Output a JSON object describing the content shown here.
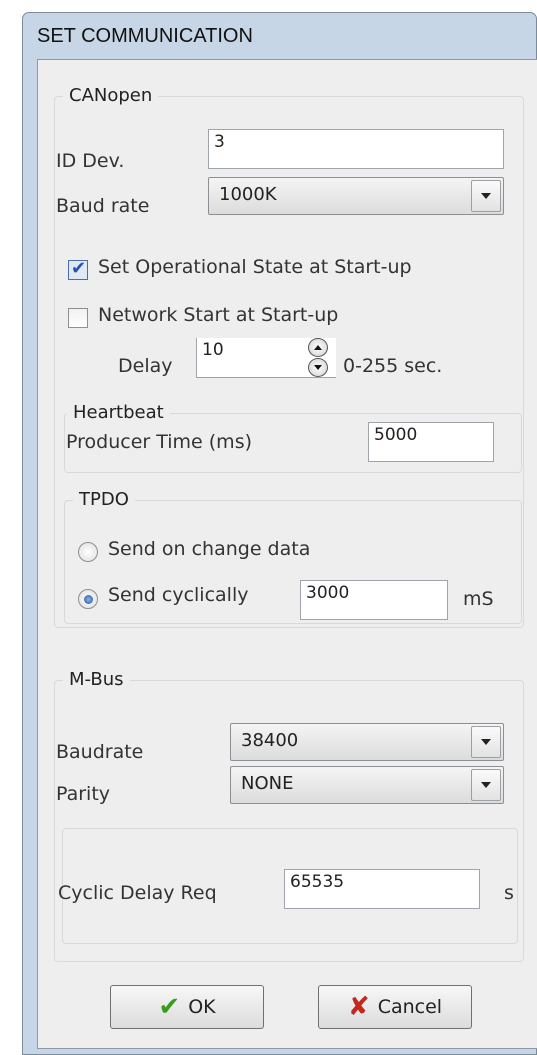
{
  "window": {
    "title": "SET COMMUNICATION"
  },
  "canopen": {
    "group_title": "CANopen",
    "id_dev_label": "ID Dev.",
    "id_dev_value": "3",
    "baud_rate_label": "Baud rate",
    "baud_rate_value": "1000K",
    "set_operational_label": "Set Operational State at Start-up",
    "set_operational_checked": true,
    "network_start_label": "Network Start at Start-up",
    "network_start_checked": false,
    "delay_label": "Delay",
    "delay_value": "10",
    "delay_range_label": "0-255 sec."
  },
  "heartbeat": {
    "group_title": "Heartbeat",
    "producer_time_label": "Producer Time (ms)",
    "producer_time_value": "5000"
  },
  "tpdo": {
    "group_title": "TPDO",
    "send_on_change_label": "Send on change data",
    "send_cyclically_label": "Send cyclically",
    "selected_option": "send_cyclically",
    "cyclic_value": "3000",
    "cyclic_unit": "mS"
  },
  "mbus": {
    "group_title": "M-Bus",
    "baudrate_label": "Baudrate",
    "baudrate_value": "38400",
    "parity_label": "Parity",
    "parity_value": "NONE",
    "cyclic_delay_label": "Cyclic Delay Req",
    "cyclic_delay_value": "65535",
    "cyclic_delay_unit": "s"
  },
  "buttons": {
    "ok_label": "OK",
    "cancel_label": "Cancel"
  },
  "colors": {
    "ok_icon": "#3d9a1f",
    "cancel_icon": "#c4271b",
    "check_tick": "#2a52a8",
    "radio_dot": "#1f4f9e"
  },
  "icons": {
    "ok": "checkmark-icon",
    "cancel": "x-icon",
    "dropdown": "chevron-down-icon",
    "spin": "spin-arrows-icon"
  }
}
